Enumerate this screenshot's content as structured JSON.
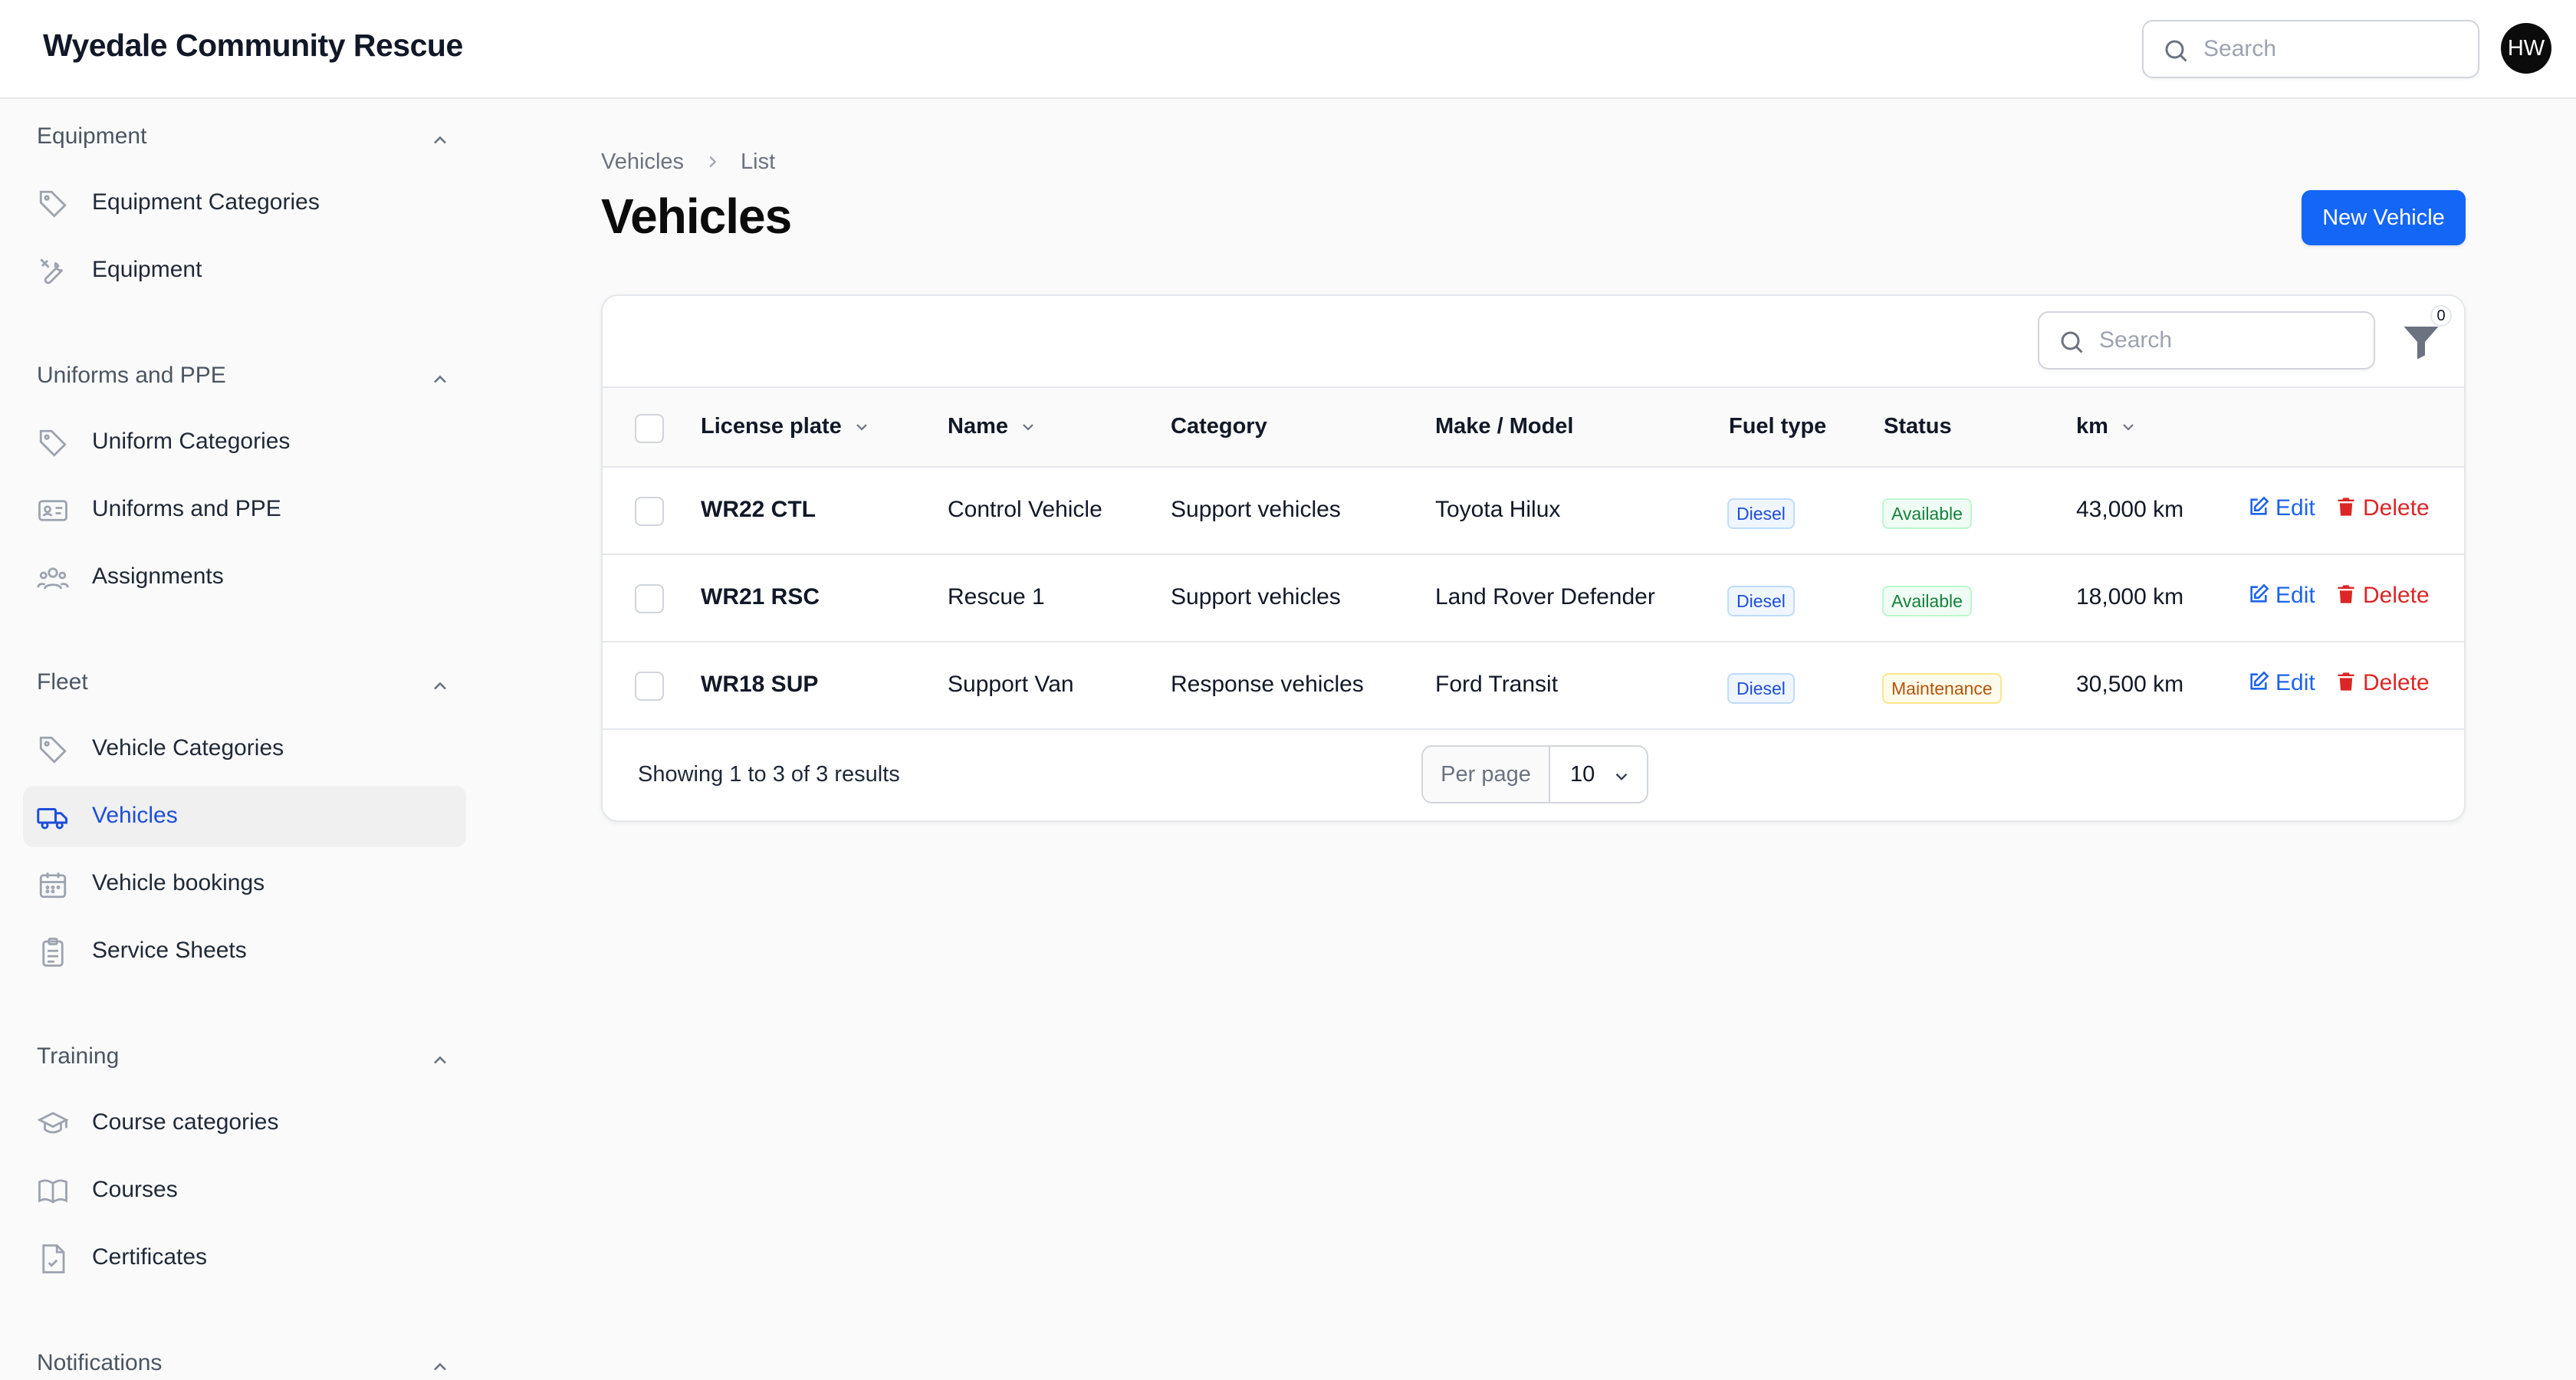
{
  "app": {
    "title": "Wyedale Community Rescue",
    "avatar_initials": "HW"
  },
  "topbar": {
    "search_placeholder": "Search"
  },
  "sidebar": {
    "groups": [
      {
        "label": "Equipment",
        "items": [
          {
            "label": "Equipment Categories",
            "icon": "tag-icon"
          },
          {
            "label": "Equipment",
            "icon": "wrench-screwdriver-icon"
          }
        ]
      },
      {
        "label": "Uniforms and PPE",
        "items": [
          {
            "label": "Uniform Categories",
            "icon": "tag-icon"
          },
          {
            "label": "Uniforms and PPE",
            "icon": "id-card-icon"
          },
          {
            "label": "Assignments",
            "icon": "users-icon"
          }
        ]
      },
      {
        "label": "Fleet",
        "items": [
          {
            "label": "Vehicle Categories",
            "icon": "tag-icon"
          },
          {
            "label": "Vehicles",
            "icon": "truck-icon",
            "active": true
          },
          {
            "label": "Vehicle bookings",
            "icon": "calendar-icon"
          },
          {
            "label": "Service Sheets",
            "icon": "clipboard-icon"
          }
        ]
      },
      {
        "label": "Training",
        "items": [
          {
            "label": "Course categories",
            "icon": "graduation-cap-icon"
          },
          {
            "label": "Courses",
            "icon": "book-icon"
          },
          {
            "label": "Certificates",
            "icon": "document-check-icon"
          }
        ]
      },
      {
        "label": "Notifications",
        "items": []
      }
    ]
  },
  "breadcrumb": {
    "parent": "Vehicles",
    "current": "List"
  },
  "page": {
    "title": "Vehicles",
    "new_button": "New Vehicle"
  },
  "table": {
    "search_placeholder": "Search",
    "filter_count": "0",
    "columns": {
      "plate": "License plate",
      "name": "Name",
      "category": "Category",
      "make": "Make / Model",
      "fuel": "Fuel type",
      "status": "Status",
      "km": "km"
    },
    "rows": [
      {
        "plate": "WR22 CTL",
        "name": "Control Vehicle",
        "category": "Support vehicles",
        "make": "Toyota Hilux",
        "fuel": "Diesel",
        "status": "Available",
        "km": "43,000 km"
      },
      {
        "plate": "WR21 RSC",
        "name": "Rescue 1",
        "category": "Support vehicles",
        "make": "Land Rover Defender",
        "fuel": "Diesel",
        "status": "Available",
        "km": "18,000 km"
      },
      {
        "plate": "WR18 SUP",
        "name": "Support Van",
        "category": "Response vehicles",
        "make": "Ford Transit",
        "fuel": "Diesel",
        "status": "Maintenance",
        "km": "30,500 km"
      }
    ],
    "actions": {
      "edit": "Edit",
      "delete": "Delete"
    },
    "footer": {
      "showing": "Showing 1 to 3 of 3 results",
      "per_page_label": "Per page",
      "per_page_value": "10"
    }
  },
  "colors": {
    "primary": "#1466f7",
    "danger": "#dc2626",
    "active_nav": "#1d4ed8"
  }
}
